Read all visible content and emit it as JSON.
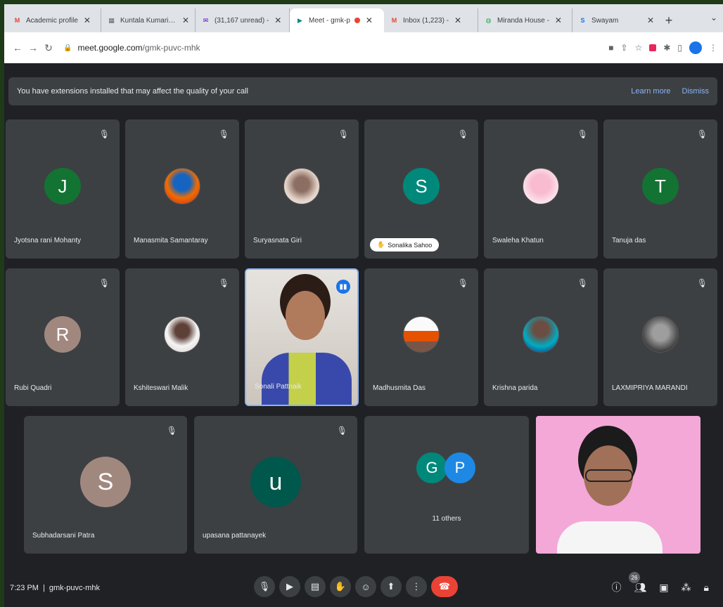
{
  "browser": {
    "tabs": [
      {
        "title": "Academic profile",
        "favicon": "gmail-icon",
        "favicon_text": "M",
        "favicon_color": "#ea4335"
      },
      {
        "title": "Kuntala Kumari Sa",
        "favicon": "doc-icon",
        "favicon_text": "▦",
        "favicon_color": "#5f6368"
      },
      {
        "title": "(31,167 unread) -",
        "favicon": "yahoo-icon",
        "favicon_text": "✉",
        "favicon_color": "#6001d2"
      },
      {
        "title": "Meet - gmk-p",
        "favicon": "meet-icon",
        "favicon_text": "▶",
        "favicon_color": "#00897b",
        "active": true,
        "recording": true
      },
      {
        "title": "Inbox (1,223) -",
        "favicon": "gmail-icon",
        "favicon_text": "M",
        "favicon_color": "#ea4335"
      },
      {
        "title": "Miranda House -",
        "favicon": "globe-icon",
        "favicon_text": "◍",
        "favicon_color": "#34a853"
      },
      {
        "title": "Swayam",
        "favicon": "swayam-icon",
        "favicon_text": "S",
        "favicon_color": "#1a73e8"
      }
    ],
    "new_tab": "+",
    "tab_menu": "⌄",
    "url_host": "meet.google.com",
    "url_path": "/gmk-puvc-mhk"
  },
  "banner": {
    "message": "You have extensions installed that may affect the quality of your call",
    "learn_more": "Learn more",
    "dismiss": "Dismiss"
  },
  "participants": {
    "jyotsna": "Jyotsna rani Mohanty",
    "manasmita": "Manasmita Samantaray",
    "suryasnata": "Suryasnata Giri",
    "sonalika": "Sonalika Sahoo",
    "swaleha": "Swaleha Khatun",
    "tanuja": "Tanuja das",
    "rubi": "Rubi Quadri",
    "kshiteswari": "Kshiteswari Malik",
    "presenter": "Sonali Pattnaik",
    "madhusmita": "Madhusmita Das",
    "krishna": "Krishna parida",
    "laxmipriya": "LAXMIPRIYA MARANDI",
    "subhadarsani": "Subhadarsani Patra",
    "upasana": "upasana pattanayek",
    "others": "11 others"
  },
  "avatars": {
    "jyotsna": "J",
    "sonalika": "S",
    "tanuja": "T",
    "rubi": "R",
    "subhadarsani": "S",
    "upasana": "u",
    "others1": "G",
    "others2": "P"
  },
  "colors": {
    "green": "#137333",
    "teal": "#00897b",
    "brown": "#a1887f",
    "dark_teal": "#00574b",
    "blue": "#1e88e5"
  },
  "meeting": {
    "time": "7:23 PM",
    "separator": "|",
    "code": "gmk-puvc-mhk",
    "participant_count": "26"
  }
}
